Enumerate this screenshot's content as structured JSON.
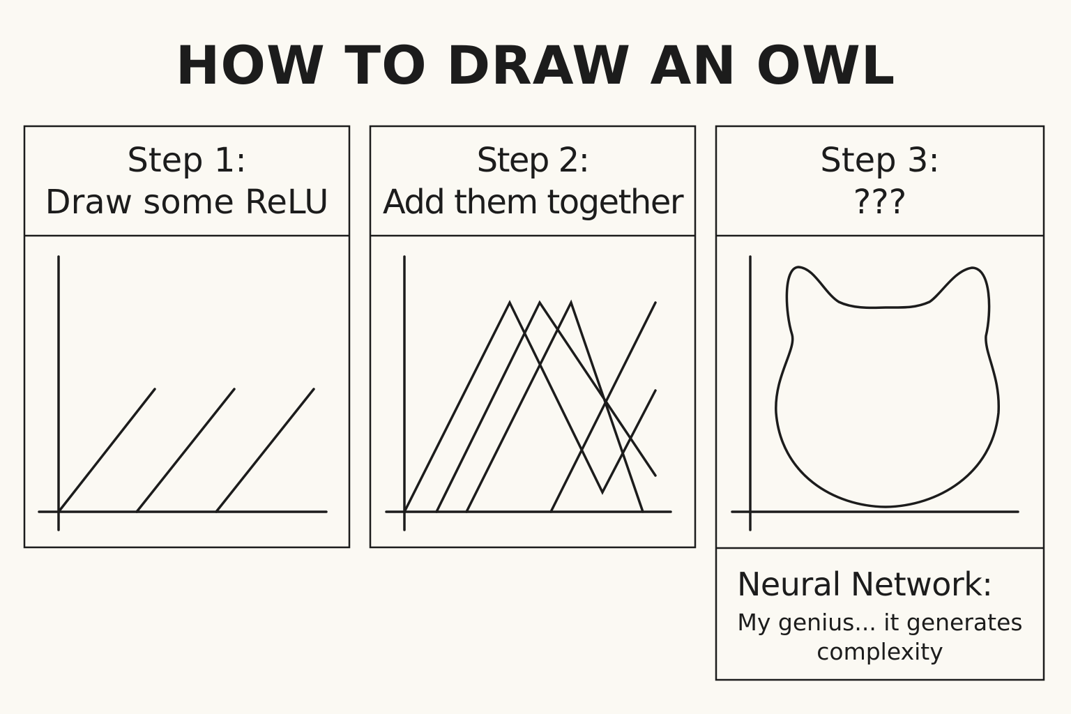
{
  "title": "HOW TO DRAW AN OWL",
  "panels": [
    {
      "step": "Step 1:",
      "caption": "Draw some ReLU"
    },
    {
      "step": "Step 2:",
      "caption": "Add them together"
    },
    {
      "step": "Step 3:",
      "caption": "???"
    }
  ],
  "punchline": {
    "heading": "Neural Network:",
    "line1": "My genius... it generates",
    "line2": "complexity"
  },
  "colors": {
    "background": "#fbf9f3",
    "ink": "#1c1c1c"
  }
}
